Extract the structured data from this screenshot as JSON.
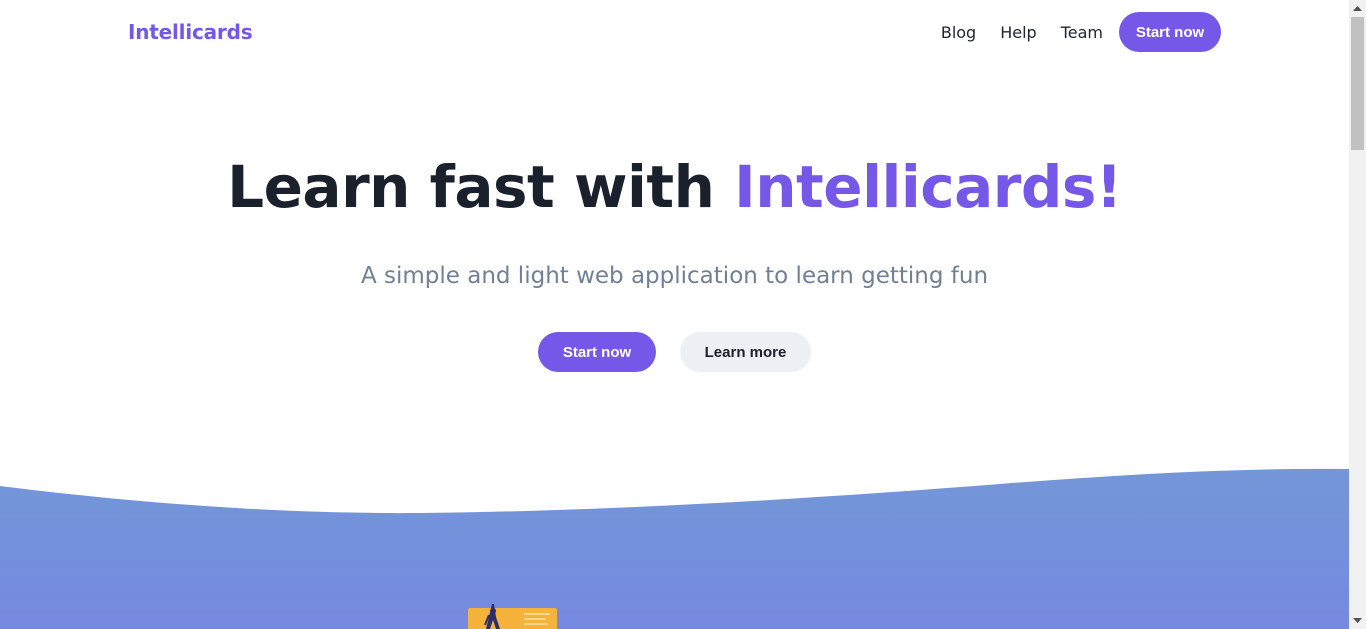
{
  "header": {
    "logo": "Intellicards",
    "nav": [
      {
        "label": "Blog"
      },
      {
        "label": "Help"
      },
      {
        "label": "Team"
      }
    ],
    "cta_label": "Start now"
  },
  "hero": {
    "title_prefix": "Learn fast with ",
    "title_accent": "Intellicards!",
    "subtitle": "A simple and light web application to learn getting fun",
    "primary_label": "Start now",
    "secondary_label": "Learn more"
  },
  "colors": {
    "accent": "#7658e8",
    "wave_top": "#7497d8",
    "wave_bottom": "#7589e0",
    "secondary_button": "#edf1f6"
  },
  "icons": {
    "illustration": "flashcard-illustration-icon",
    "scroll_up": "scroll-up-arrow-icon",
    "scroll_down": "scroll-down-arrow-icon"
  }
}
